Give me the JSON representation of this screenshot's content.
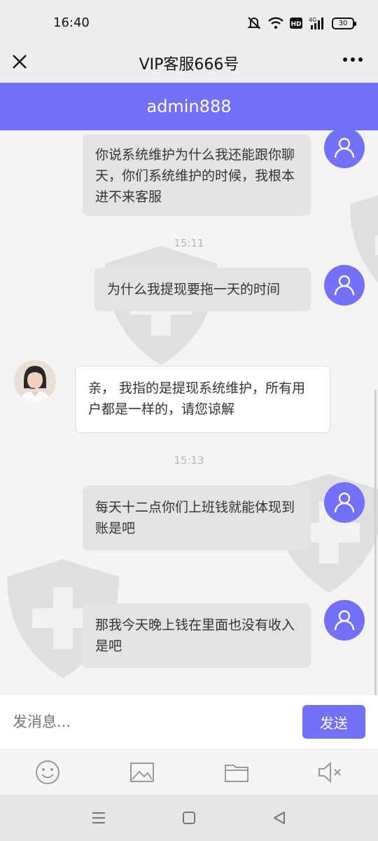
{
  "status": {
    "time": "16:40",
    "battery": "30"
  },
  "header": {
    "title": "VIP客服666号",
    "banner": "admin888"
  },
  "messages": [
    {
      "side": "out",
      "text": "你说系统维护为什么我还能跟你聊天，你们系统维护的时候，我根本进不来客服"
    },
    {
      "type": "time",
      "text": "15:11"
    },
    {
      "side": "out",
      "text": "为什么我提现要拖一天的时间"
    },
    {
      "side": "in",
      "text": "亲， 我指的是提现系统维护，所有用户都是一样的，请您谅解"
    },
    {
      "type": "time",
      "text": "15:13"
    },
    {
      "side": "out",
      "text": "每天十二点你们上班钱就能体现到账是吧"
    },
    {
      "side": "out",
      "text": "那我今天晚上钱在里面也没有收入是吧"
    }
  ],
  "input": {
    "placeholder": "发消息...",
    "send_label": "发送"
  },
  "toolbar": [
    "emoji-icon",
    "image-icon",
    "folder-icon",
    "mute-icon"
  ],
  "navbar": [
    "menu-icon",
    "home-icon",
    "back-icon"
  ],
  "colors": {
    "accent": "#7470f7",
    "bubble_out": "#e3e3e3",
    "bubble_in": "#ffffff"
  }
}
